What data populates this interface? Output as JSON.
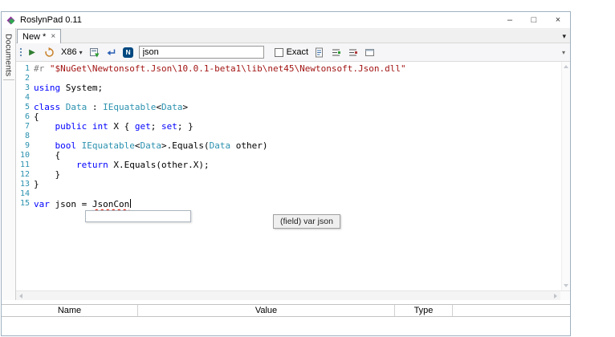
{
  "window": {
    "title": "RoslynPad 0.11",
    "controls": {
      "minimize": "–",
      "maximize": "□",
      "close": "×"
    }
  },
  "sidebar": {
    "label": "Documents"
  },
  "tabbar": {
    "tab_label": "New *",
    "tab_close": "×",
    "menu_icon": "▾"
  },
  "toolbar": {
    "run_icon": "▶",
    "platform": "X86",
    "dropdown_icon": "▾",
    "nuget_letter": "N",
    "search_value": "json",
    "exact_label": "Exact",
    "overflow_icon": "▾"
  },
  "editor": {
    "lines": [
      {
        "segs": [
          [
            "pre",
            "#r "
          ],
          [
            "str",
            "\"$NuGet\\Newtonsoft.Json\\10.0.1-beta1\\lib\\net45\\Newtonsoft.Json.dll\""
          ]
        ]
      },
      {
        "segs": []
      },
      {
        "segs": [
          [
            "kw",
            "using"
          ],
          [
            "pln",
            " System;"
          ]
        ]
      },
      {
        "segs": []
      },
      {
        "segs": [
          [
            "kw",
            "class"
          ],
          [
            "pln",
            " "
          ],
          [
            "typ",
            "Data"
          ],
          [
            "pln",
            " : "
          ],
          [
            "typ",
            "IEquatable"
          ],
          [
            "pln",
            "<"
          ],
          [
            "typ",
            "Data"
          ],
          [
            "pln",
            ">"
          ]
        ]
      },
      {
        "segs": [
          [
            "pln",
            "{"
          ]
        ]
      },
      {
        "segs": [
          [
            "pln",
            "    "
          ],
          [
            "kw",
            "public"
          ],
          [
            "pln",
            " "
          ],
          [
            "kw",
            "int"
          ],
          [
            "pln",
            " X { "
          ],
          [
            "kw",
            "get"
          ],
          [
            "pln",
            "; "
          ],
          [
            "kw",
            "set"
          ],
          [
            "pln",
            "; }"
          ]
        ]
      },
      {
        "segs": []
      },
      {
        "segs": [
          [
            "pln",
            "    "
          ],
          [
            "kw",
            "bool"
          ],
          [
            "pln",
            " "
          ],
          [
            "typ",
            "IEquatable"
          ],
          [
            "pln",
            "<"
          ],
          [
            "typ",
            "Data"
          ],
          [
            "pln",
            ">.Equals("
          ],
          [
            "typ",
            "Data"
          ],
          [
            "pln",
            " other)"
          ]
        ]
      },
      {
        "segs": [
          [
            "pln",
            "    {"
          ]
        ]
      },
      {
        "segs": [
          [
            "pln",
            "        "
          ],
          [
            "kw",
            "return"
          ],
          [
            "pln",
            " X.Equals(other.X);"
          ]
        ]
      },
      {
        "segs": [
          [
            "pln",
            "    }"
          ]
        ]
      },
      {
        "segs": [
          [
            "pln",
            "}"
          ]
        ]
      },
      {
        "segs": []
      },
      {
        "segs": [
          [
            "kw",
            "var"
          ],
          [
            "pln",
            " json = "
          ],
          [
            "err",
            "JsonCon"
          ]
        ],
        "caret": true
      }
    ]
  },
  "popups": {
    "tooltip": "(field) var json"
  },
  "grid": {
    "columns": [
      "Name",
      "Value",
      "Type"
    ]
  },
  "colors": {
    "keyword": "#0000ff",
    "type": "#2b91af",
    "string": "#a31515",
    "preprocessor": "#808080",
    "line_number": "#2b91af",
    "error_squiggle": "#e51400",
    "nuget_blue": "#004880"
  }
}
